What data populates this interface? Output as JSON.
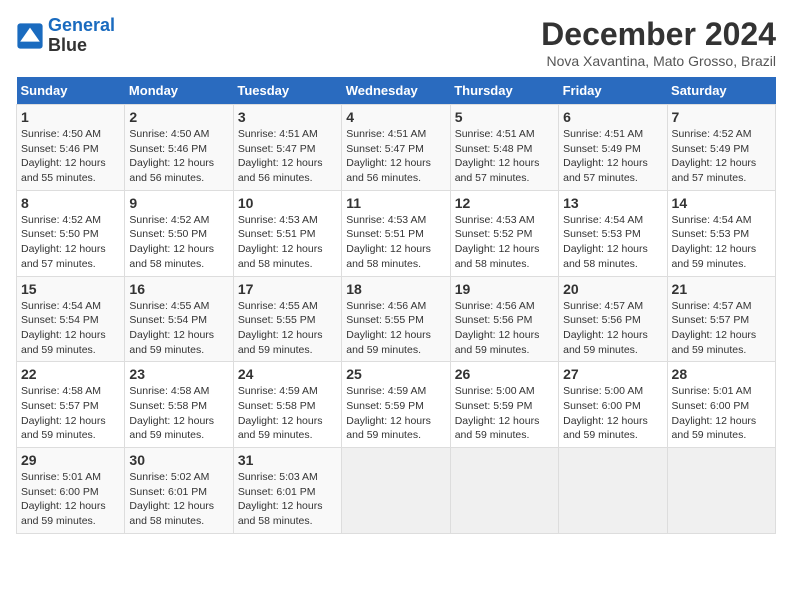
{
  "logo": {
    "line1": "General",
    "line2": "Blue"
  },
  "title": "December 2024",
  "subtitle": "Nova Xavantina, Mato Grosso, Brazil",
  "days_of_week": [
    "Sunday",
    "Monday",
    "Tuesday",
    "Wednesday",
    "Thursday",
    "Friday",
    "Saturday"
  ],
  "weeks": [
    [
      {
        "day": 1,
        "info": "Sunrise: 4:50 AM\nSunset: 5:46 PM\nDaylight: 12 hours\nand 55 minutes."
      },
      {
        "day": 2,
        "info": "Sunrise: 4:50 AM\nSunset: 5:46 PM\nDaylight: 12 hours\nand 56 minutes."
      },
      {
        "day": 3,
        "info": "Sunrise: 4:51 AM\nSunset: 5:47 PM\nDaylight: 12 hours\nand 56 minutes."
      },
      {
        "day": 4,
        "info": "Sunrise: 4:51 AM\nSunset: 5:47 PM\nDaylight: 12 hours\nand 56 minutes."
      },
      {
        "day": 5,
        "info": "Sunrise: 4:51 AM\nSunset: 5:48 PM\nDaylight: 12 hours\nand 57 minutes."
      },
      {
        "day": 6,
        "info": "Sunrise: 4:51 AM\nSunset: 5:49 PM\nDaylight: 12 hours\nand 57 minutes."
      },
      {
        "day": 7,
        "info": "Sunrise: 4:52 AM\nSunset: 5:49 PM\nDaylight: 12 hours\nand 57 minutes."
      }
    ],
    [
      {
        "day": 8,
        "info": "Sunrise: 4:52 AM\nSunset: 5:50 PM\nDaylight: 12 hours\nand 57 minutes."
      },
      {
        "day": 9,
        "info": "Sunrise: 4:52 AM\nSunset: 5:50 PM\nDaylight: 12 hours\nand 58 minutes."
      },
      {
        "day": 10,
        "info": "Sunrise: 4:53 AM\nSunset: 5:51 PM\nDaylight: 12 hours\nand 58 minutes."
      },
      {
        "day": 11,
        "info": "Sunrise: 4:53 AM\nSunset: 5:51 PM\nDaylight: 12 hours\nand 58 minutes."
      },
      {
        "day": 12,
        "info": "Sunrise: 4:53 AM\nSunset: 5:52 PM\nDaylight: 12 hours\nand 58 minutes."
      },
      {
        "day": 13,
        "info": "Sunrise: 4:54 AM\nSunset: 5:53 PM\nDaylight: 12 hours\nand 58 minutes."
      },
      {
        "day": 14,
        "info": "Sunrise: 4:54 AM\nSunset: 5:53 PM\nDaylight: 12 hours\nand 59 minutes."
      }
    ],
    [
      {
        "day": 15,
        "info": "Sunrise: 4:54 AM\nSunset: 5:54 PM\nDaylight: 12 hours\nand 59 minutes."
      },
      {
        "day": 16,
        "info": "Sunrise: 4:55 AM\nSunset: 5:54 PM\nDaylight: 12 hours\nand 59 minutes."
      },
      {
        "day": 17,
        "info": "Sunrise: 4:55 AM\nSunset: 5:55 PM\nDaylight: 12 hours\nand 59 minutes."
      },
      {
        "day": 18,
        "info": "Sunrise: 4:56 AM\nSunset: 5:55 PM\nDaylight: 12 hours\nand 59 minutes."
      },
      {
        "day": 19,
        "info": "Sunrise: 4:56 AM\nSunset: 5:56 PM\nDaylight: 12 hours\nand 59 minutes."
      },
      {
        "day": 20,
        "info": "Sunrise: 4:57 AM\nSunset: 5:56 PM\nDaylight: 12 hours\nand 59 minutes."
      },
      {
        "day": 21,
        "info": "Sunrise: 4:57 AM\nSunset: 5:57 PM\nDaylight: 12 hours\nand 59 minutes."
      }
    ],
    [
      {
        "day": 22,
        "info": "Sunrise: 4:58 AM\nSunset: 5:57 PM\nDaylight: 12 hours\nand 59 minutes."
      },
      {
        "day": 23,
        "info": "Sunrise: 4:58 AM\nSunset: 5:58 PM\nDaylight: 12 hours\nand 59 minutes."
      },
      {
        "day": 24,
        "info": "Sunrise: 4:59 AM\nSunset: 5:58 PM\nDaylight: 12 hours\nand 59 minutes."
      },
      {
        "day": 25,
        "info": "Sunrise: 4:59 AM\nSunset: 5:59 PM\nDaylight: 12 hours\nand 59 minutes."
      },
      {
        "day": 26,
        "info": "Sunrise: 5:00 AM\nSunset: 5:59 PM\nDaylight: 12 hours\nand 59 minutes."
      },
      {
        "day": 27,
        "info": "Sunrise: 5:00 AM\nSunset: 6:00 PM\nDaylight: 12 hours\nand 59 minutes."
      },
      {
        "day": 28,
        "info": "Sunrise: 5:01 AM\nSunset: 6:00 PM\nDaylight: 12 hours\nand 59 minutes."
      }
    ],
    [
      {
        "day": 29,
        "info": "Sunrise: 5:01 AM\nSunset: 6:00 PM\nDaylight: 12 hours\nand 59 minutes."
      },
      {
        "day": 30,
        "info": "Sunrise: 5:02 AM\nSunset: 6:01 PM\nDaylight: 12 hours\nand 58 minutes."
      },
      {
        "day": 31,
        "info": "Sunrise: 5:03 AM\nSunset: 6:01 PM\nDaylight: 12 hours\nand 58 minutes."
      },
      null,
      null,
      null,
      null
    ]
  ]
}
